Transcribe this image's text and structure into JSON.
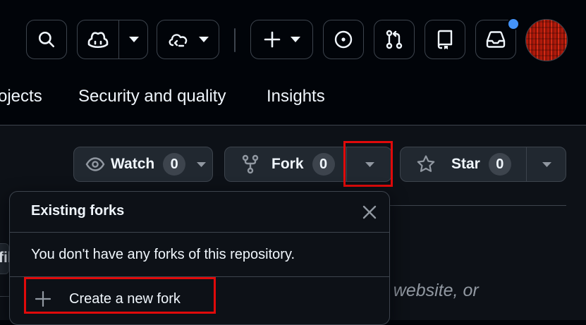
{
  "header": {
    "icons": {
      "search": "search-icon",
      "copilot": "copilot-icon",
      "copilot_menu": "triangle-down-icon",
      "codespaces": "cloud-icon",
      "codespaces_menu": "triangle-down-icon",
      "create": "plus-icon",
      "create_menu": "triangle-down-icon",
      "issues": "issue-opened-icon",
      "pull_requests": "git-pull-request-icon",
      "repositories": "repo-icon",
      "inbox": "inbox-icon"
    },
    "notification_dot_color": "#4493f8"
  },
  "repo_nav": {
    "tabs": [
      {
        "label": "ojects"
      },
      {
        "label": "Security and quality"
      },
      {
        "label": "Insights"
      }
    ]
  },
  "actions": {
    "watch": {
      "label": "Watch",
      "count": "0"
    },
    "fork": {
      "label": "Fork",
      "count": "0"
    },
    "star": {
      "label": "Star",
      "count": "0"
    }
  },
  "fork_popover": {
    "title": "Existing forks",
    "message": "You don't have any forks of this repository.",
    "create_label": "Create a new fork"
  },
  "background": {
    "about_partial": "n, website, or",
    "left_partial": "fil"
  },
  "colors": {
    "page_bg": "#010409",
    "panel_bg": "#0d1117",
    "button_bg": "#212830",
    "border": "#3d444d",
    "text": "#f0f6fc",
    "muted": "#9198a1",
    "highlight": "#e00a0a"
  }
}
